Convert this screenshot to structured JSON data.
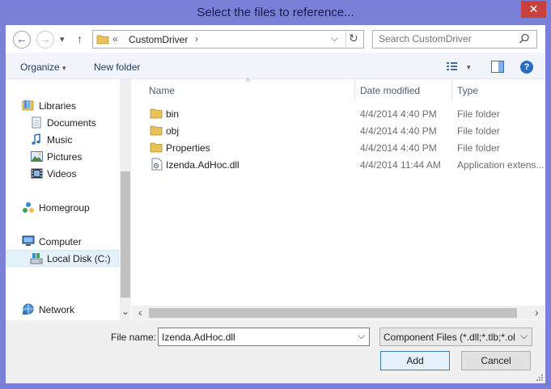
{
  "window": {
    "title": "Select the files to reference...",
    "close_glyph": "✕"
  },
  "nav": {
    "back_glyph": "←",
    "forward_glyph": "→",
    "recent_glyph": "▾",
    "up_glyph": "↑",
    "breadcrumb_prefix": "«",
    "breadcrumb": "CustomDriver",
    "breadcrumb_chevron": "›",
    "address_dropdown_glyph": "⌵",
    "refresh_glyph": "↻",
    "search_placeholder": "Search CustomDriver",
    "search_icon": "🔍"
  },
  "toolbar": {
    "organize_label": "Organize",
    "organize_arrow": "▾",
    "new_folder_label": "New folder",
    "view_arrow": "▾",
    "help_glyph": "?"
  },
  "sidebar": {
    "libraries": "Libraries",
    "documents": "Documents",
    "music": "Music",
    "pictures": "Pictures",
    "videos": "Videos",
    "homegroup": "Homegroup",
    "computer": "Computer",
    "local_disk": "Local Disk (C:)",
    "network": "Network",
    "scroll_down_glyph": "⌄"
  },
  "columns": {
    "name": "Name",
    "date_modified": "Date modified",
    "type": "Type",
    "sort_glyph": "^"
  },
  "files": [
    {
      "name": "bin",
      "date": "4/4/2014 4:40 PM",
      "type": "File folder",
      "icon": "folder-icon"
    },
    {
      "name": "obj",
      "date": "4/4/2014 4:40 PM",
      "type": "File folder",
      "icon": "folder-icon"
    },
    {
      "name": "Properties",
      "date": "4/4/2014 4:40 PM",
      "type": "File folder",
      "icon": "folder-icon"
    },
    {
      "name": "Izenda.AdHoc.dll",
      "date": "4/4/2014 11:44 AM",
      "type": "Application extens...",
      "icon": "dll-file-icon"
    }
  ],
  "hscroll": {
    "left_glyph": "‹",
    "right_glyph": "›"
  },
  "bottom": {
    "file_name_label": "File name:",
    "file_name_value": "Izenda.AdHoc.dll",
    "file_name_arrow": "⌵",
    "filter_value": "Component Files (*.dll;*.tlb;*.ol",
    "filter_arrow": "⌵",
    "add_label": "Add",
    "cancel_label": "Cancel"
  },
  "colors": {
    "titlebar": "#7a7fd8",
    "close": "#c9413d",
    "toolbar": "#f1f5fb",
    "folder": "#e8c15a"
  }
}
